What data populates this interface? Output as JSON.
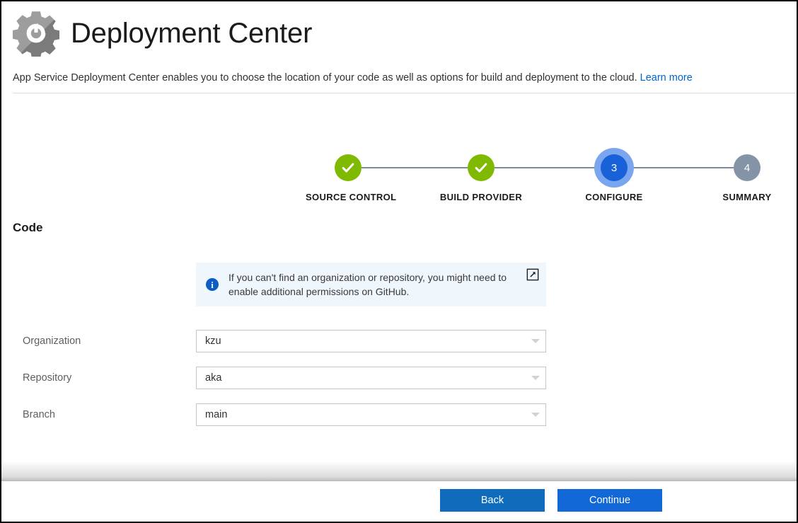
{
  "header": {
    "icon": "deployment-gear-icon",
    "title": "Deployment Center",
    "subtitle_text": "App Service Deployment Center enables you to choose the location of your code as well as options for build and deployment to the cloud.",
    "learn_more_label": "Learn more"
  },
  "wizard": {
    "steps": [
      {
        "label": "SOURCE CONTROL",
        "state": "done",
        "marker": "check"
      },
      {
        "label": "BUILD PROVIDER",
        "state": "done",
        "marker": "check"
      },
      {
        "label": "CONFIGURE",
        "state": "current",
        "marker": "3"
      },
      {
        "label": "SUMMARY",
        "state": "pending",
        "marker": "4"
      }
    ],
    "colors": {
      "done": "#7fba00",
      "current": "#1861d8",
      "current_halo": "#7aa5ef",
      "pending": "#8494a6",
      "connector": "#7c8a99"
    }
  },
  "section": {
    "title": "Code"
  },
  "info_banner": {
    "icon": "info-icon",
    "text": "If you can't find an organization or repository, you might need to enable additional permissions on GitHub.",
    "external_link_icon": "external-link-icon",
    "background": "#eff6fc"
  },
  "form": {
    "fields": [
      {
        "label": "Organization",
        "value": "kzu",
        "placeholder": "Select organization"
      },
      {
        "label": "Repository",
        "value": "aka",
        "placeholder": "Select repository"
      },
      {
        "label": "Branch",
        "value": "main",
        "placeholder": "Select branch"
      }
    ]
  },
  "footer": {
    "back_label": "Back",
    "continue_label": "Continue",
    "button_color": "#1268d6"
  }
}
